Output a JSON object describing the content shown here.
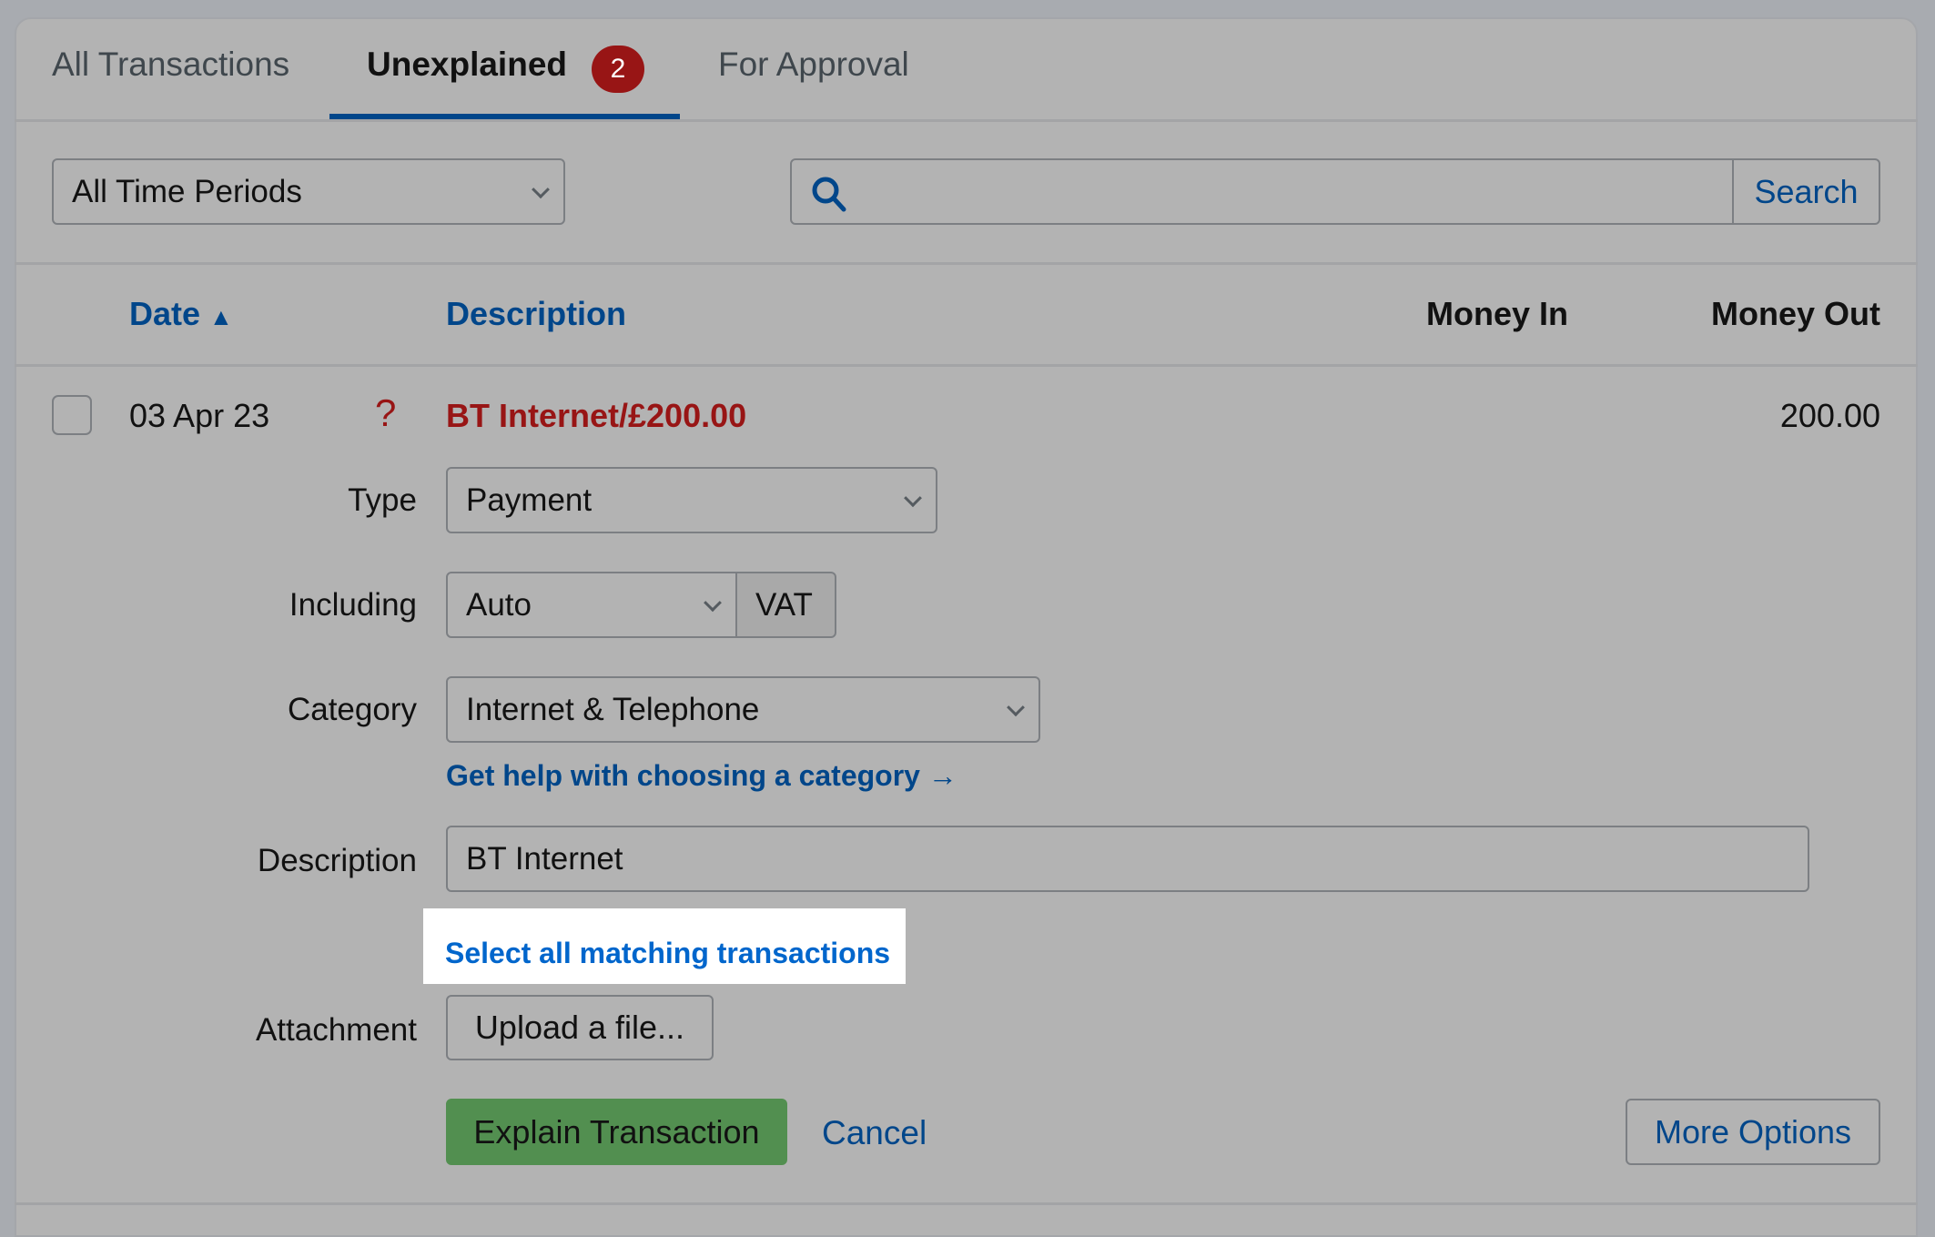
{
  "tabs": [
    {
      "label": "All Transactions"
    },
    {
      "label": "Unexplained",
      "badge": "2"
    },
    {
      "label": "For Approval"
    }
  ],
  "filters": {
    "period": "All Time Periods",
    "search_value": "",
    "search_button": "Search"
  },
  "columns": {
    "date": "Date",
    "description": "Description",
    "money_in": "Money In",
    "money_out": "Money Out"
  },
  "transaction": {
    "date": "03 Apr 23",
    "status_icon": "?",
    "description": "BT Internet/£200.00",
    "money_in": "",
    "money_out": "200.00"
  },
  "form": {
    "type_label": "Type",
    "type_value": "Payment",
    "including_label": "Including",
    "including_value": "Auto",
    "vat_label": "VAT",
    "category_label": "Category",
    "category_value": "Internet & Telephone",
    "category_help": "Get help with choosing a category →",
    "description_label": "Description",
    "description_value": "BT Internet",
    "select_matching": "Select all matching transactions",
    "attachment_label": "Attachment",
    "upload_button": "Upload a file...",
    "explain_button": "Explain Transaction",
    "cancel_button": "Cancel",
    "more_options_button": "More Options"
  },
  "colors": {
    "accent": "#00468a",
    "danger": "#981515",
    "success": "#528f50",
    "link_highlight": "#0066cc"
  }
}
